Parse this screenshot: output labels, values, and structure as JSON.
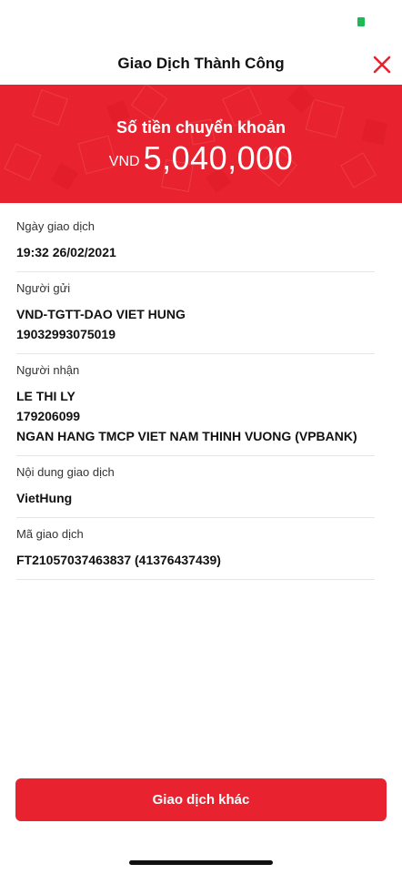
{
  "header": {
    "title": "Giao Dịch Thành Công",
    "close_icon": "close-icon"
  },
  "colors": {
    "brand_red": "#e8222e",
    "status_green": "#1db954"
  },
  "banner": {
    "label": "Số tiền chuyển khoản",
    "currency": "VND",
    "amount": "5,040,000"
  },
  "details": {
    "date": {
      "label": "Ngày giao dịch",
      "value": "19:32 26/02/2021"
    },
    "sender": {
      "label": "Người gửi",
      "name": "VND-TGTT-DAO VIET HUNG",
      "account": "19032993075019"
    },
    "recipient": {
      "label": "Người nhận",
      "name": "LE THI LY",
      "account": "179206099",
      "bank": "NGAN HANG TMCP VIET NAM THINH VUONG (VPBANK)"
    },
    "content": {
      "label": "Nội dung giao dịch",
      "value": "VietHung"
    },
    "transaction_id": {
      "label": "Mã giao dịch",
      "value": "FT21057037463837 (41376437439)"
    }
  },
  "actions": {
    "other_transaction_label": "Giao dịch khác"
  }
}
